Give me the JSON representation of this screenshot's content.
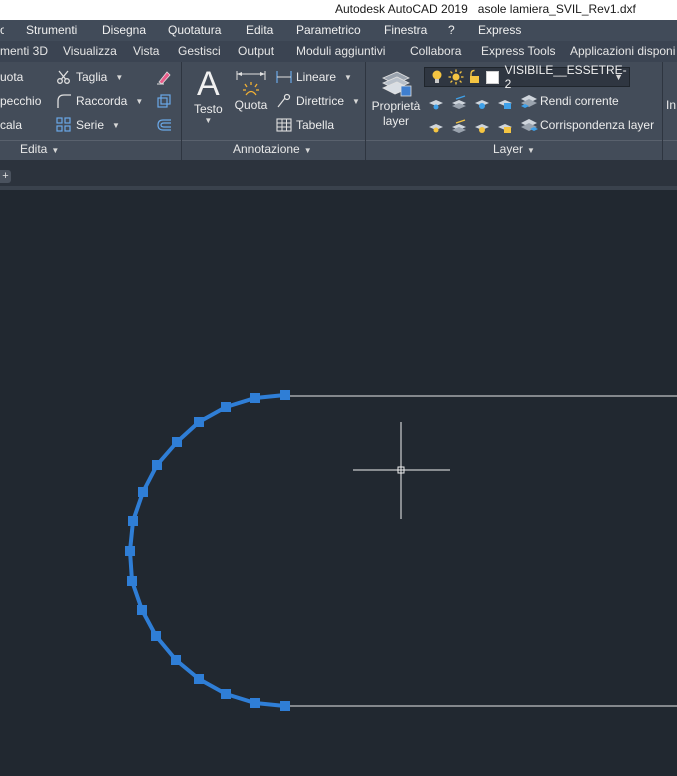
{
  "titlebar": {
    "app": "Autodesk AutoCAD 2019",
    "file": "asole lamiera_SVIL_Rev1.dxf"
  },
  "menu": [
    "Strumenti",
    "Disegna",
    "Quotatura",
    "Edita",
    "Parametrico",
    "Finestra",
    "?",
    "Express"
  ],
  "tabs": [
    "menti 3D",
    "Visualizza",
    "Vista",
    "Gestisci",
    "Output",
    "Moduli aggiuntivi",
    "Collabora",
    "Express Tools",
    "Applicazioni disponi"
  ],
  "edit_panel": {
    "items": [
      "uota",
      "pecchio",
      "cala",
      "Taglia",
      "Raccorda",
      "Serie"
    ],
    "label": "Edita"
  },
  "annot_panel": {
    "testo": "Testo",
    "quota": "Quota",
    "items": [
      "Lineare",
      "Direttrice",
      "Tabella"
    ],
    "label": "Annotazione"
  },
  "layer_panel": {
    "props_label_1": "Proprietà",
    "props_label_2": "layer",
    "layer_name": "VISIBILE__ESSETRE-2",
    "rendi": "Rendi corrente",
    "corrisp": "Corrispondenza layer",
    "label": "Layer"
  },
  "right_panel": {
    "label": "In"
  },
  "colors": {
    "accent": "#2f7ed6",
    "background": "#212830",
    "line": "#e8e8e8",
    "ribbon": "#434c59"
  },
  "icons": [
    "scissors-icon",
    "fillet-icon",
    "array-icon",
    "eraser-icon",
    "text-icon",
    "dimension-icon",
    "linear-dim-icon",
    "leader-icon",
    "table-icon",
    "layer-properties-icon",
    "lightbulb-icon",
    "sun-icon",
    "lock-icon",
    "color-swatch-icon",
    "crosshair-cursor"
  ]
}
